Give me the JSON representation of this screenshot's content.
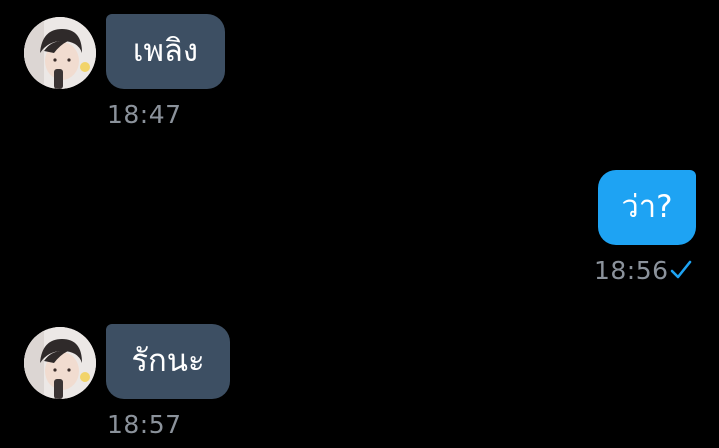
{
  "messages": [
    {
      "direction": "incoming",
      "text": "เพลิง",
      "time": "18:47",
      "avatar": "contact-avatar"
    },
    {
      "direction": "outgoing",
      "text": "ว่า?",
      "time": "18:56",
      "status_icon": "checkmark-icon"
    },
    {
      "direction": "incoming",
      "text": "รักนะ",
      "time": "18:57",
      "avatar": "contact-avatar"
    }
  ],
  "colors": {
    "background": "#000000",
    "incoming_bubble": "#3d4f63",
    "outgoing_bubble": "#1ea3f3",
    "timestamp": "#8b929b",
    "checkmark": "#1ea3f3"
  }
}
